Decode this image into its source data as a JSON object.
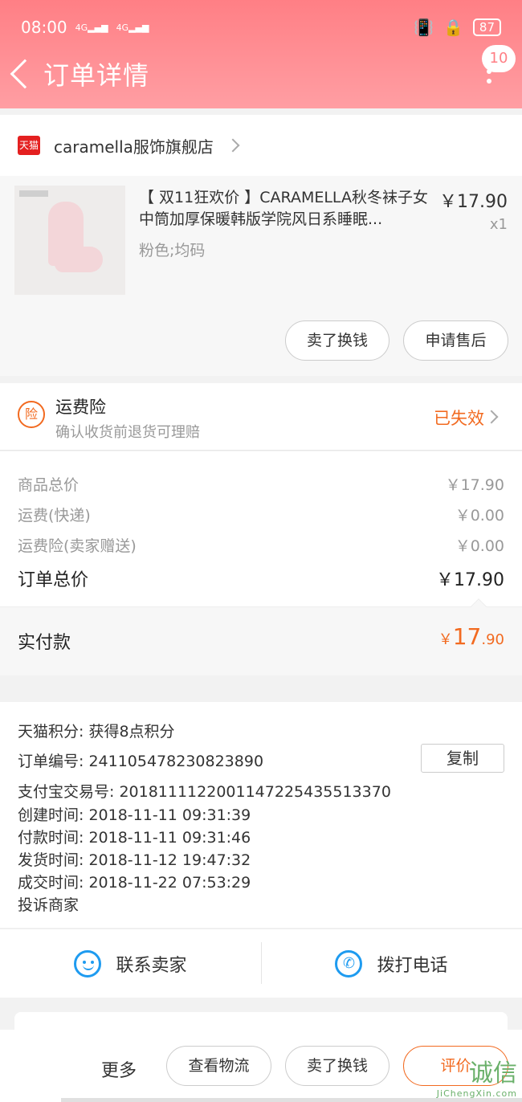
{
  "status_bar": {
    "time": "08:00",
    "signal1": "4G",
    "signal2": "4G",
    "battery": "87"
  },
  "nav": {
    "title": "订单详情",
    "message_badge": "10"
  },
  "shop": {
    "badge": "天猫",
    "name": "caramella服饰旗舰店"
  },
  "item": {
    "title": "【 双11狂欢价 】CARAMELLA秋冬袜子女中筒加厚保暖韩版学院风日系睡眠...",
    "sku": "粉色;均码",
    "price": "￥17.90",
    "qty": "x1",
    "btn_sell": "卖了换钱",
    "btn_after_sale": "申请售后"
  },
  "insurance": {
    "icon_text": "险",
    "title": "运费险",
    "subtitle": "确认收货前退货可理赔",
    "status": "已失效"
  },
  "costs": [
    {
      "label": "商品总价",
      "value": "￥17.90"
    },
    {
      "label": "运费(快递)",
      "value": "￥0.00"
    },
    {
      "label": "运费险(卖家赠送)",
      "value": "￥0.00"
    }
  ],
  "order_total": {
    "label": "订单总价",
    "value": "￥17.90"
  },
  "paid": {
    "label": "实付款",
    "currency": "￥",
    "int": "17",
    "dec": ".90"
  },
  "info": {
    "points": "天猫积分:   获得8点积分",
    "order_no": "订单编号:   241105478230823890",
    "alipay_no": "支付宝交易号:   2018111122001147225435513370",
    "created": "创建时间:   2018-11-11 09:31:39",
    "paid_time": "付款时间:   2018-11-11 09:31:46",
    "shipped": "发货时间:   2018-11-12 19:47:32",
    "closed": "成交时间:   2018-11-22 07:53:29",
    "complain": "投诉商家",
    "copy": "复制"
  },
  "contact": {
    "seller": "联系卖家",
    "phone": "拨打电话"
  },
  "actions": {
    "more": "更多",
    "logistics": "查看物流",
    "sell": "卖了换钱",
    "review": "评价"
  },
  "watermark": {
    "big": "诚信",
    "small": "JiChengXin.com"
  }
}
